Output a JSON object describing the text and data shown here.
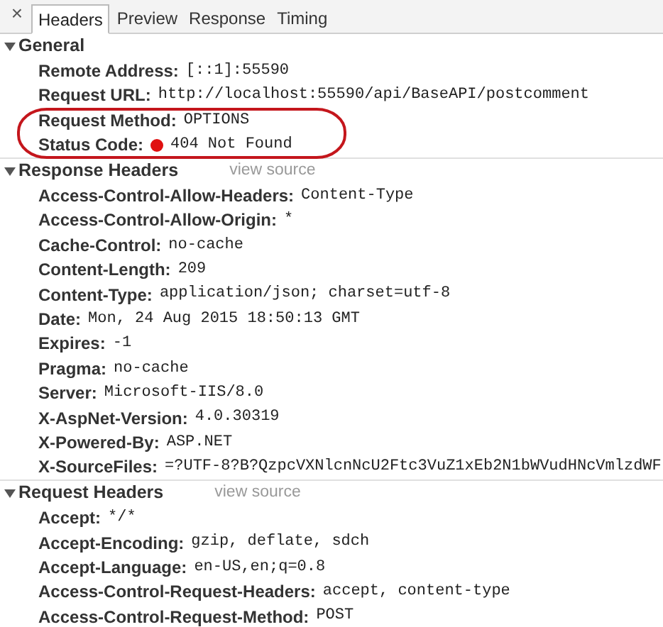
{
  "tabs": [
    {
      "label": "Headers",
      "selected": true
    },
    {
      "label": "Preview",
      "selected": false
    },
    {
      "label": "Response",
      "selected": false
    },
    {
      "label": "Timing",
      "selected": false
    }
  ],
  "close_icon": "×",
  "sections": [
    {
      "title": "General",
      "expanded": true,
      "rows": [
        {
          "name": "Remote Address:",
          "value": "[::1]:55590"
        },
        {
          "name": "Request URL:",
          "value": "http://localhost:55590/api/BaseAPI/postcomment"
        },
        {
          "name": "Request Method:",
          "value": "OPTIONS",
          "circled": true
        },
        {
          "name": "Status Code:",
          "value": "404 Not Found",
          "color": "#e01010",
          "circled": true
        }
      ]
    },
    {
      "title": "Response Headers",
      "link": "view source",
      "expanded": true,
      "rows": [
        {
          "name": "Access-Control-Allow-Headers:",
          "value": "Content-Type"
        },
        {
          "name": "Access-Control-Allow-Origin:",
          "value": "*"
        },
        {
          "name": "Cache-Control:",
          "value": "no-cache"
        },
        {
          "name": "Content-Length:",
          "value": "209"
        },
        {
          "name": "Content-Type:",
          "value": "application/json; charset=utf-8"
        },
        {
          "name": "Date:",
          "value": "Mon, 24 Aug 2015 18:50:13 GMT"
        },
        {
          "name": "Expires:",
          "value": "-1"
        },
        {
          "name": "Pragma:",
          "value": "no-cache"
        },
        {
          "name": "Server:",
          "value": "Microsoft-IIS/8.0"
        },
        {
          "name": "X-AspNet-Version:",
          "value": "4.0.30319"
        },
        {
          "name": "X-Powered-By:",
          "value": "ASP.NET"
        },
        {
          "name": "X-SourceFiles:",
          "value": "=?UTF-8?B?QzpcVXNlcnNcU2Ftc3VuZ1xEb2N1bWVudHNcVmlzdWF"
        }
      ]
    },
    {
      "title": "Request Headers",
      "link": "view source",
      "expanded": true,
      "rows": [
        {
          "name": "Accept:",
          "value": "*/*"
        },
        {
          "name": "Accept-Encoding:",
          "value": "gzip, deflate, sdch"
        },
        {
          "name": "Accept-Language:",
          "value": "en-US,en;q=0.8"
        },
        {
          "name": "Access-Control-Request-Headers:",
          "value": "accept, content-type"
        },
        {
          "name": "Access-Control-Request-Method:",
          "value": "POST"
        }
      ]
    }
  ]
}
